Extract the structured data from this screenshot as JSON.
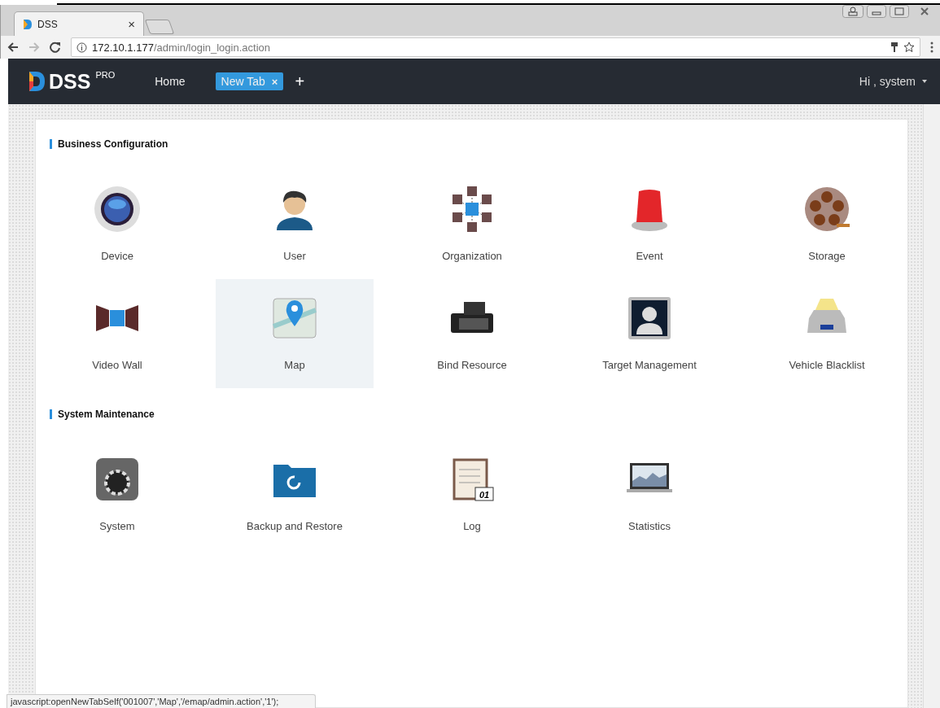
{
  "browser": {
    "tab_title": "DSS",
    "tab_close": "×",
    "url_host": "172.10.1.177",
    "url_path": "/admin/login_login.action"
  },
  "navbar": {
    "logo": "DSS",
    "logo_badge": "PRO",
    "links": [
      {
        "label": "Home",
        "selected": false
      },
      {
        "label": "New Tab",
        "selected": true,
        "close": "×"
      }
    ],
    "add": "+",
    "user": "Hi , system"
  },
  "sections": [
    {
      "title": "Business Configuration",
      "items": [
        {
          "kind": "device",
          "label": "Device",
          "hovered": false
        },
        {
          "kind": "user",
          "label": "User",
          "hovered": false
        },
        {
          "kind": "organization",
          "label": "Organization",
          "hovered": false
        },
        {
          "kind": "event",
          "label": "Event",
          "hovered": false
        },
        {
          "kind": "storage",
          "label": "Storage",
          "hovered": false
        },
        {
          "kind": "videowall",
          "label": "Video Wall",
          "hovered": false
        },
        {
          "kind": "map",
          "label": "Map",
          "hovered": true
        },
        {
          "kind": "bind",
          "label": "Bind Resource",
          "hovered": false
        },
        {
          "kind": "target",
          "label": "Target Management",
          "hovered": false
        },
        {
          "kind": "vehicle",
          "label": "Vehicle Blacklist",
          "hovered": false
        }
      ]
    },
    {
      "title": "System Maintenance",
      "items": [
        {
          "kind": "system",
          "label": "System",
          "hovered": false
        },
        {
          "kind": "backup",
          "label": "Backup and Restore",
          "hovered": false
        },
        {
          "kind": "log",
          "label": "Log",
          "hovered": false,
          "icon_text": "01"
        },
        {
          "kind": "statistics",
          "label": "Statistics",
          "hovered": false
        }
      ]
    }
  ],
  "status_bar": "javascript:openNewTabSelf('001007','Map','/emap/admin.action','1');"
}
